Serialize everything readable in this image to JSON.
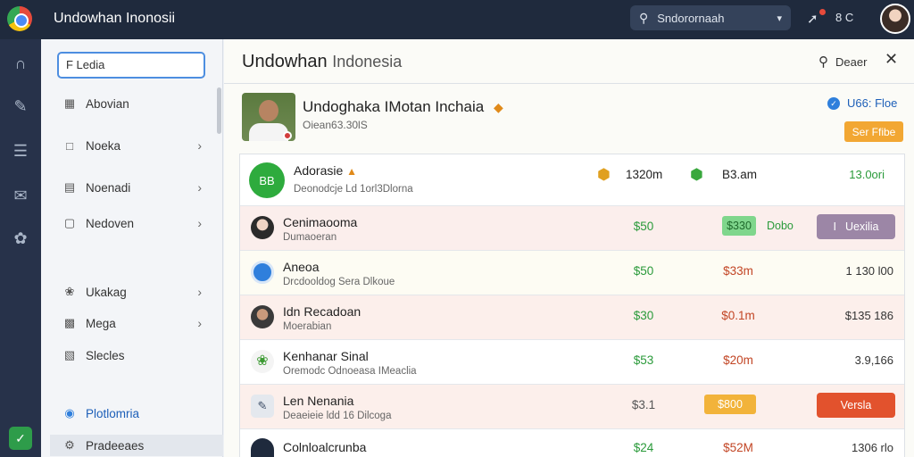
{
  "topbar": {
    "app_title": "Undowhan Inonosii",
    "search_value": "Sndorornaah",
    "badge_text": "8 C"
  },
  "sidebar": {
    "search_value": "F Ledia",
    "items": [
      {
        "label": "Abovian",
        "icon": "grid-icon",
        "chevron": false
      },
      {
        "label": "Noeka",
        "icon": "chat-icon",
        "chevron": true
      },
      {
        "label": "Noenadi",
        "icon": "document-icon",
        "chevron": true
      },
      {
        "label": "Nedoven",
        "icon": "message-icon",
        "chevron": true
      },
      {
        "label": "Ukakag",
        "icon": "puzzle-icon",
        "chevron": true
      },
      {
        "label": "Mega",
        "icon": "file-icon",
        "chevron": true
      },
      {
        "label": "Slecles",
        "icon": "list-icon",
        "chevron": false
      },
      {
        "label": "Plotlomria",
        "icon": "target-icon",
        "chevron": false
      },
      {
        "label": "Pradeeaes",
        "icon": "settings-icon",
        "chevron": false
      }
    ]
  },
  "main": {
    "title_a": "Undowhan",
    "title_b": "Indonesia",
    "search_label": "Deaer",
    "profile": {
      "name": "Undoghaka IMotan Inchaia",
      "sub": "Oiean63.30lS",
      "follow_link": "U66: Floe",
      "follow_button": "Ser Ffibe"
    },
    "summary": {
      "name": "Adorasie",
      "sub": "Deonodcje Ld 1orl3Dlorna",
      "v1": "1320m",
      "v2": "B3.am",
      "v3": "13.0ori",
      "avatar_text": "BB"
    },
    "rows": [
      {
        "name": "Cenimaooma",
        "sub": "Dumaoeran",
        "c1": "$50",
        "pill": "$330",
        "c3": "Dobo",
        "action": "Uexilia",
        "action_color": "#9c86a6",
        "action_icon": "I"
      },
      {
        "name": "Aneoa",
        "sub": "Drcdooldog Sera Dlkoue",
        "c1": "$50",
        "c2": "$33m",
        "c3": "1 130 l00"
      },
      {
        "name": "Idn Recadoan",
        "sub": "Moerabian",
        "c1": "$30",
        "c2": "$0.1m",
        "c3": "$135 186"
      },
      {
        "name": "Kenhanar Sinal",
        "sub": "Oremodc Odnoeasa IMeaclia",
        "c1": "$53",
        "c2": "$20m",
        "c3": "3.9,166"
      },
      {
        "name": "Len Nenania",
        "sub": "Deaeieie ldd 16 Dilcoga",
        "c1": "$3.1",
        "pill": "$800",
        "action": "Versla",
        "action_color": "#e2522d"
      },
      {
        "name": "Colnloalcrunba",
        "sub": "",
        "c1": "$24",
        "c2": "$52M",
        "c3": "1306 rlo"
      }
    ]
  }
}
